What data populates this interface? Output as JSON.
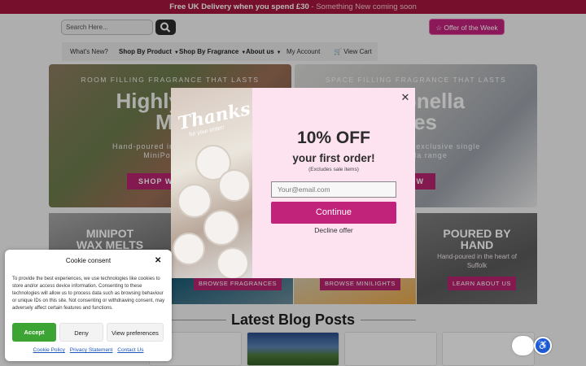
{
  "announcement": {
    "strong": "Free UK Delivery when you spend £30",
    "rest": " - Something New coming soon"
  },
  "header": {
    "search_placeholder": "Search Here...",
    "offer_label": "Offer of the Week"
  },
  "nav": {
    "items": [
      {
        "label": "What's New?"
      },
      {
        "label": "Shop By Product"
      },
      {
        "label": "Shop By Fragrance"
      },
      {
        "label": "About us"
      },
      {
        "label": "My Account"
      },
      {
        "label": "View Cart"
      }
    ]
  },
  "heroes": [
    {
      "kicker": "ROOM FILLING FRAGRANCE THAT LASTS",
      "title_line1": "Highly Sce",
      "title_line2": "Me",
      "sub_line1": "Hand-poured in the UK - 250",
      "sub_line2": "MiniPots - 10",
      "cta": "SHOP WA"
    },
    {
      "kicker": "SPACE FILLING FRAGRANCE THAT LASTS",
      "title_line1": "Citronella",
      "title_line2": "dles",
      "sub_line1": "nce without our exclusive single",
      "sub_line2": "citronella range",
      "cta": "NOW"
    }
  ],
  "tiles": [
    {
      "title_line1": "MINIPOT",
      "title_line2": "WAX MELTS",
      "sub": "",
      "cta": ""
    },
    {
      "title_line1": "",
      "title_line2": "",
      "sub": "",
      "cta": "BROWSE FRAGRANCES"
    },
    {
      "title_line1": "",
      "title_line2": "",
      "sub": "",
      "cta": "BROWSE MINILIGHTS"
    },
    {
      "title_line1": "POURED BY",
      "title_line2": "HAND",
      "sub_line1": "Hand-poured in the heart of",
      "sub_line2": "Suffolk",
      "cta": "LEARN ABOUT US"
    }
  ],
  "blog": {
    "title": "Latest Blog Posts"
  },
  "popup": {
    "image_text": "Thanks",
    "image_subtext": "for your order!",
    "headline": "10% OFF",
    "subheadline": "your first order!",
    "exclusion": "(Excludes sale items)",
    "email_placeholder": "Your@email.com",
    "continue_label": "Continue",
    "decline_label": "Decline offer",
    "close_icon": "close-icon"
  },
  "cookie": {
    "title": "Cookie consent",
    "body": "To provide the best experiences, we use technologies like cookies to store and/or access device information. Consenting to these technologies will allow us to process data such as browsing behaviour or unique IDs on this site. Not consenting or withdrawing consent, may adversely affect certain features and functions.",
    "accept": "Accept",
    "deny": "Deny",
    "preferences": "View preferences",
    "links": [
      "Cookie Policy",
      "Privacy Statement",
      "Contact Us"
    ]
  },
  "colors": {
    "brand_pink": "#c1227a",
    "announcement_bg": "#a3163c",
    "accept_green": "#3ca432",
    "accessibility_blue": "#1e5ad8"
  }
}
